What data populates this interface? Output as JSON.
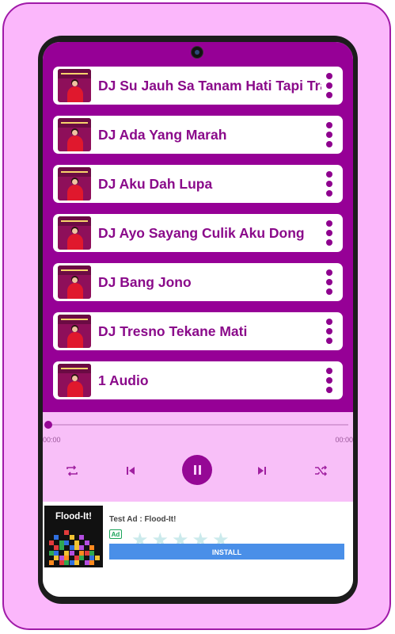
{
  "playlist": {
    "items": [
      {
        "title": "DJ Su Jauh Sa Tanam Hati Tapi Tra Hasil"
      },
      {
        "title": "DJ Ada Yang Marah"
      },
      {
        "title": "DJ Aku Dah Lupa"
      },
      {
        "title": "DJ Ayo Sayang Culik Aku Dong"
      },
      {
        "title": "DJ Bang Jono"
      },
      {
        "title": "DJ Tresno Tekane Mati"
      },
      {
        "title": "1 Audio"
      }
    ]
  },
  "player": {
    "current_time": "00:00",
    "total_time": "00:00",
    "progress": 0,
    "state": "playing"
  },
  "ad": {
    "app_name": "Flood-It!",
    "title": "Test Ad : Flood-It!",
    "badge": "Ad",
    "install_label": "INSTALL",
    "stars": "★★★★★"
  },
  "colors": {
    "accent": "#960096",
    "background": "#fbb7fb",
    "player_bg": "#f8bff8",
    "install": "#4a8fe8"
  }
}
